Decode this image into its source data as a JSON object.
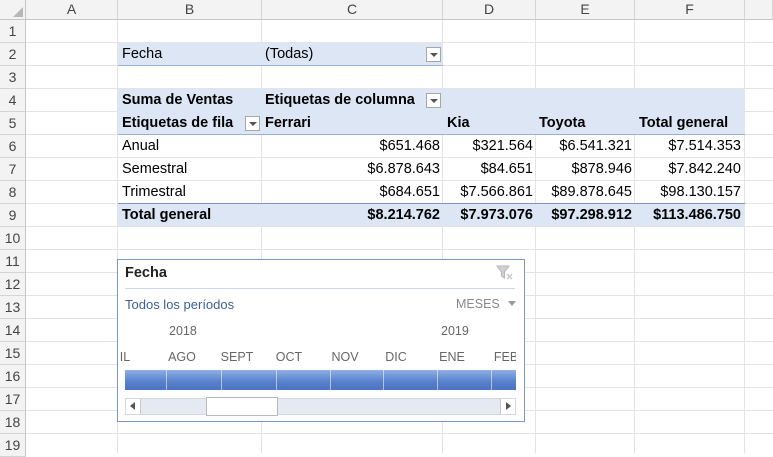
{
  "columns": [
    "A",
    "B",
    "C",
    "D",
    "E",
    "F"
  ],
  "rows": [
    "1",
    "2",
    "3",
    "4",
    "5",
    "6",
    "7",
    "8",
    "9",
    "10",
    "11",
    "12",
    "13",
    "14",
    "15",
    "16",
    "17",
    "18",
    "19"
  ],
  "filter": {
    "label": "Fecha",
    "value": "(Todas)"
  },
  "pivot": {
    "values_label": "Suma de Ventas",
    "column_labels": "Etiquetas de columna",
    "row_labels": "Etiquetas de fila",
    "headers": [
      "Ferrari",
      "Kia",
      "Toyota",
      "Total general"
    ],
    "rows": [
      {
        "label": "Anual",
        "values": [
          "$651.468",
          "$321.564",
          "$6.541.321",
          "$7.514.353"
        ]
      },
      {
        "label": "Semestral",
        "values": [
          "$6.878.643",
          "$84.651",
          "$878.946",
          "$7.842.240"
        ]
      },
      {
        "label": "Trimestral",
        "values": [
          "$684.651",
          "$7.566.861",
          "$89.878.645",
          "$98.130.157"
        ]
      }
    ],
    "total": {
      "label": "Total general",
      "values": [
        "$8.214.762",
        "$7.973.076",
        "$97.298.912",
        "$113.486.750"
      ]
    }
  },
  "slicer": {
    "title": "Fecha",
    "all_periods": "Todos los períodos",
    "level": "MESES",
    "years": [
      "2018",
      "2019"
    ],
    "months": [
      "IL",
      "AGO",
      "SEPT",
      "OCT",
      "NOV",
      "DIC",
      "ENE",
      "FEB"
    ],
    "colors": {
      "border": "#7a98c4",
      "bar": "#5b84cf",
      "text": "#3b5f96"
    }
  }
}
